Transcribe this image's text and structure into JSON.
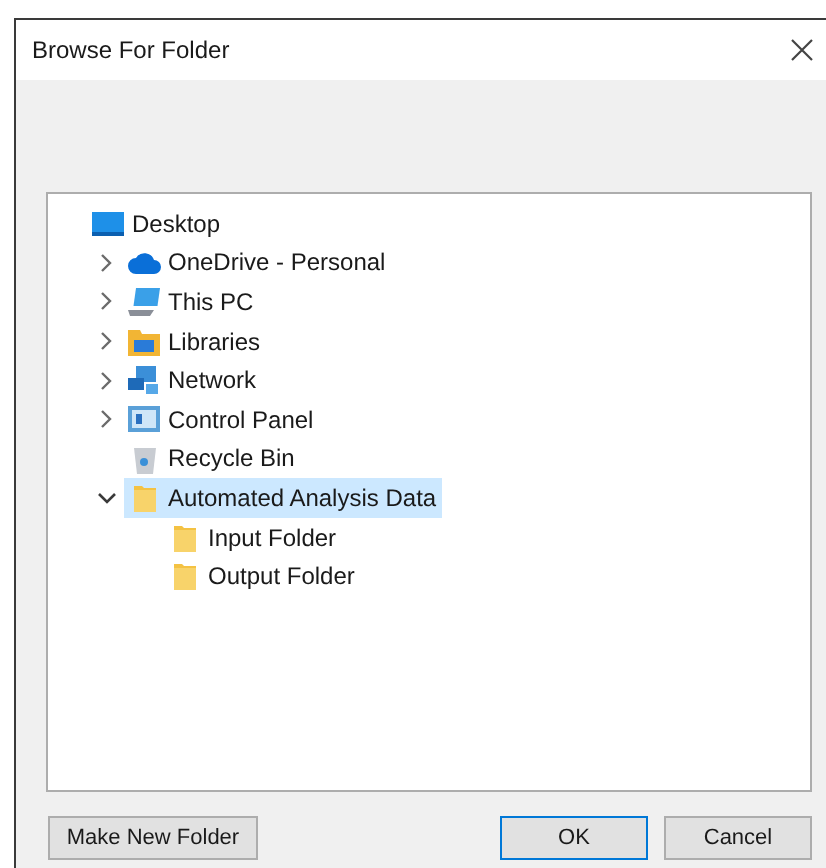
{
  "window": {
    "title": "Browse For Folder"
  },
  "tree": [
    {
      "label": "Desktop",
      "kind": "desktop",
      "expandable": false,
      "expanded": false,
      "selected": false,
      "children": [
        {
          "label": "OneDrive - Personal",
          "kind": "cloud",
          "expandable": true,
          "expanded": false,
          "selected": false
        },
        {
          "label": "This PC",
          "kind": "pc",
          "expandable": true,
          "expanded": false,
          "selected": false
        },
        {
          "label": "Libraries",
          "kind": "libraries",
          "expandable": true,
          "expanded": false,
          "selected": false
        },
        {
          "label": "Network",
          "kind": "network",
          "expandable": true,
          "expanded": false,
          "selected": false
        },
        {
          "label": "Control Panel",
          "kind": "panel",
          "expandable": true,
          "expanded": false,
          "selected": false
        },
        {
          "label": "Recycle Bin",
          "kind": "bin",
          "expandable": false,
          "expanded": false,
          "selected": false
        },
        {
          "label": "Automated Analysis Data",
          "kind": "folder",
          "expandable": true,
          "expanded": true,
          "selected": true,
          "children": [
            {
              "label": "Input Folder",
              "kind": "folder",
              "expandable": false,
              "expanded": false,
              "selected": false
            },
            {
              "label": "Output Folder",
              "kind": "folder",
              "expandable": false,
              "expanded": false,
              "selected": false
            }
          ]
        }
      ]
    }
  ],
  "buttons": {
    "make_new_folder": "Make New Folder",
    "ok": "OK",
    "cancel": "Cancel"
  }
}
